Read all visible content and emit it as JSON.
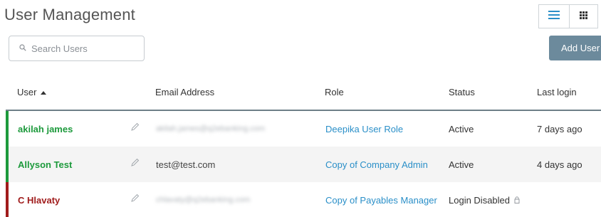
{
  "header": {
    "title": "User Management",
    "list_view_icon": "list-view-icon",
    "grid_view_icon": "grid-view-icon"
  },
  "search": {
    "placeholder": "Search Users",
    "value": "",
    "icon": "search-icon"
  },
  "toolbar": {
    "add_user_label": "Add User"
  },
  "table": {
    "columns": [
      "User",
      "Email Address",
      "Role",
      "Status",
      "Last login"
    ],
    "sort_column": "User",
    "sort_direction": "ascending",
    "rows": [
      {
        "user": "akilah james",
        "email": "akilah.james@q2ebanking.com",
        "email_blurred": true,
        "role": "Deepika User Role",
        "status": "Active",
        "last_login": "7 days ago",
        "state": "active"
      },
      {
        "user": "Allyson Test",
        "email": "test@test.com",
        "email_blurred": false,
        "role": "Copy of Company Admin",
        "status": "Active",
        "last_login": "4 days ago",
        "state": "active"
      },
      {
        "user": "C Hlavaty",
        "email": "chlavaty@q2ebanking.com",
        "email_blurred": true,
        "role": "Copy of Payables Manager",
        "status": "Login Disabled",
        "status_icon": "lock-icon",
        "last_login": "",
        "state": "disabled"
      }
    ]
  },
  "colors": {
    "active_accent": "#1d9a3c",
    "disabled_accent": "#a01c1c",
    "link": "#2a8fc8",
    "button": "#6c8a9c",
    "header_rule": "#6e7f88"
  }
}
